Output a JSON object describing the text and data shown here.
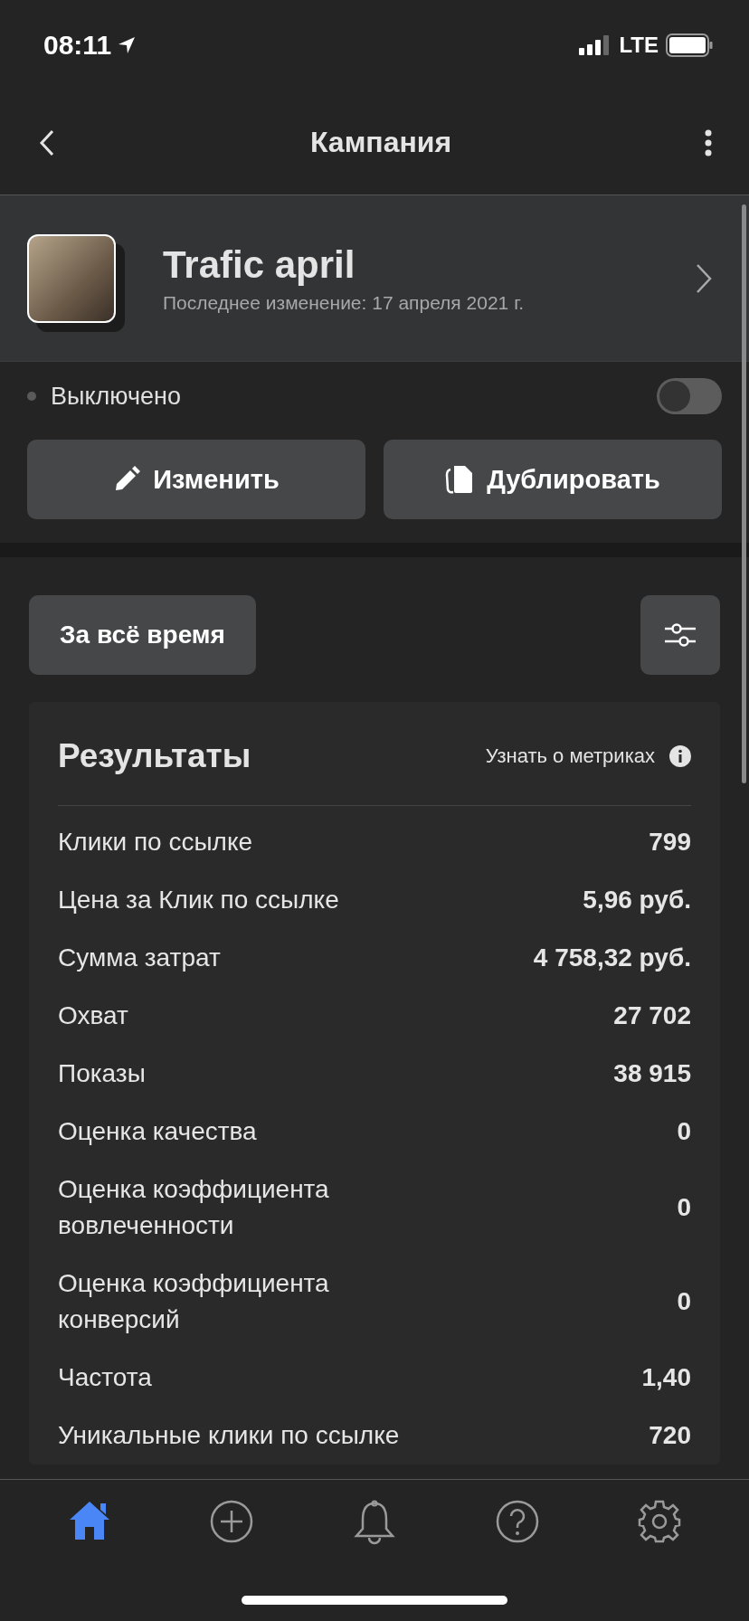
{
  "status_bar": {
    "time": "08:11",
    "network": "LTE"
  },
  "nav": {
    "title": "Кампания"
  },
  "campaign": {
    "name": "Trafic april",
    "subtitle": "Последнее изменение: 17 апреля 2021 г."
  },
  "state": {
    "label": "Выключено",
    "on": false
  },
  "actions": [
    {
      "label": "Изменить",
      "kind": "edit"
    },
    {
      "label": "Дублировать",
      "kind": "duplicate"
    }
  ],
  "period": {
    "label": "За всё время"
  },
  "results": {
    "title": "Результаты",
    "link": "Узнать о метриках",
    "rows": [
      {
        "label": "Клики по ссылке",
        "value": "799"
      },
      {
        "label": "Цена за Клик по ссылке",
        "value": "5,96 руб."
      },
      {
        "label": "Сумма затрат",
        "value": "4 758,32 руб."
      },
      {
        "label": "Охват",
        "value": "27 702"
      },
      {
        "label": "Показы",
        "value": "38 915"
      },
      {
        "label": "Оценка качества",
        "value": "0"
      },
      {
        "label": "Оценка коэффициента вовлеченности",
        "value": "0"
      },
      {
        "label": "Оценка коэффициента конверсий",
        "value": "0"
      },
      {
        "label": "Частота",
        "value": "1,40"
      },
      {
        "label": "Уникальные клики по ссылке",
        "value": "720"
      }
    ]
  },
  "tab_bar": {
    "items": [
      {
        "kind": "home",
        "selected": true
      },
      {
        "kind": "add",
        "selected": false
      },
      {
        "kind": "bell",
        "selected": false
      },
      {
        "kind": "help",
        "selected": false
      },
      {
        "kind": "settings",
        "selected": false
      }
    ]
  }
}
